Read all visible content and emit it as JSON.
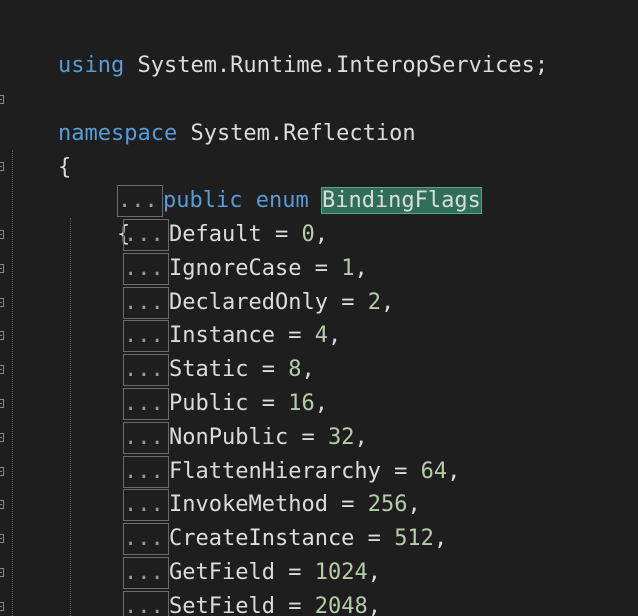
{
  "editor": {
    "using_line": {
      "keyword": "using",
      "text": " System.Runtime.InteropServices;"
    },
    "namespace_line": {
      "keyword": "namespace",
      "text": " System.Reflection"
    },
    "open_brace_ns": "{",
    "enum_line": {
      "collapsed": "...",
      "keyword_public": "public",
      "keyword_enum": "enum",
      "name": "BindingFlags"
    },
    "open_brace_enum": "{",
    "members": [
      {
        "collapsed": "...",
        "name": "Default",
        "op": " = ",
        "value": "0",
        "sep": ","
      },
      {
        "collapsed": "...",
        "name": "IgnoreCase",
        "op": " = ",
        "value": "1",
        "sep": ","
      },
      {
        "collapsed": "...",
        "name": "DeclaredOnly",
        "op": " = ",
        "value": "2",
        "sep": ","
      },
      {
        "collapsed": "...",
        "name": "Instance",
        "op": " = ",
        "value": "4",
        "sep": ","
      },
      {
        "collapsed": "...",
        "name": "Static",
        "op": " = ",
        "value": "8",
        "sep": ","
      },
      {
        "collapsed": "...",
        "name": "Public",
        "op": " = ",
        "value": "16",
        "sep": ","
      },
      {
        "collapsed": "...",
        "name": "NonPublic",
        "op": " = ",
        "value": "32",
        "sep": ","
      },
      {
        "collapsed": "...",
        "name": "FlattenHierarchy",
        "op": " = ",
        "value": "64",
        "sep": ","
      },
      {
        "collapsed": "...",
        "name": "InvokeMethod",
        "op": " = ",
        "value": "256",
        "sep": ","
      },
      {
        "collapsed": "...",
        "name": "CreateInstance",
        "op": " = ",
        "value": "512",
        "sep": ","
      },
      {
        "collapsed": "...",
        "name": "GetField",
        "op": " = ",
        "value": "1024",
        "sep": ","
      },
      {
        "collapsed": "...",
        "name": "SetField",
        "op": " = ",
        "value": "2048",
        "sep": ","
      }
    ],
    "colors": {
      "background": "#1e1e1e",
      "keyword": "#569cd6",
      "number": "#b5cea8",
      "plain": "#dcdcdc",
      "highlight": "#2f6f5a"
    }
  }
}
